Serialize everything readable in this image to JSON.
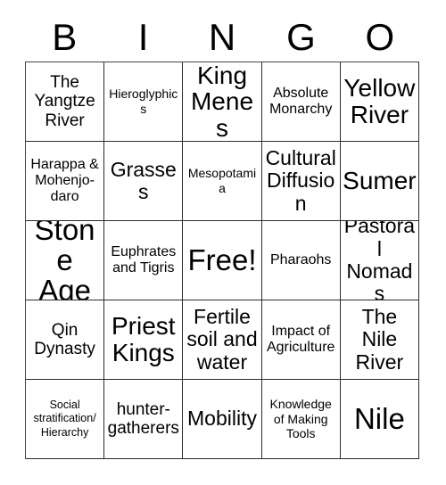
{
  "card": {
    "title_letters": [
      "B",
      "I",
      "N",
      "G",
      "O"
    ],
    "free_space_label": "Free!",
    "grid_size": "5x5",
    "text_color": "#000000",
    "border_color": "#2b2b2b",
    "background_color": "#ffffff"
  },
  "rows": [
    [
      {
        "text": "The Yangtze River",
        "size": "lg"
      },
      {
        "text": "Hieroglyphics",
        "size": "sm"
      },
      {
        "text": "King Menes",
        "size": "xxl"
      },
      {
        "text": "Absolute Monarchy",
        "size": "md"
      },
      {
        "text": "Yellow River",
        "size": "xxl"
      }
    ],
    [
      {
        "text": "Harappa & Mohenjo-daro",
        "size": "md"
      },
      {
        "text": "Grasses",
        "size": "xl"
      },
      {
        "text": "Mesopotamia",
        "size": "sm"
      },
      {
        "text": "Cultural Diffusion",
        "size": "xl"
      },
      {
        "text": "Sumer",
        "size": "xxl"
      }
    ],
    [
      {
        "text": "Stone Age",
        "size": "huge"
      },
      {
        "text": "Euphrates and Tigris",
        "size": "md"
      },
      {
        "text": "Free!",
        "size": "huge"
      },
      {
        "text": "Pharaohs",
        "size": "md"
      },
      {
        "text": "Pastoral Nomads",
        "size": "xl"
      }
    ],
    [
      {
        "text": "Qin Dynasty",
        "size": "lg"
      },
      {
        "text": "Priest Kings",
        "size": "xxl"
      },
      {
        "text": "Fertile soil and water",
        "size": "xl"
      },
      {
        "text": "Impact of Agriculture",
        "size": "md"
      },
      {
        "text": "The Nile River",
        "size": "xl"
      }
    ],
    [
      {
        "text": "Social stratification/ Hierarchy",
        "size": "xs"
      },
      {
        "text": "hunter-gatherers",
        "size": "lg"
      },
      {
        "text": "Mobility",
        "size": "xl"
      },
      {
        "text": "Knowledge of Making Tools",
        "size": "sm"
      },
      {
        "text": "Nile",
        "size": "huge"
      }
    ]
  ]
}
